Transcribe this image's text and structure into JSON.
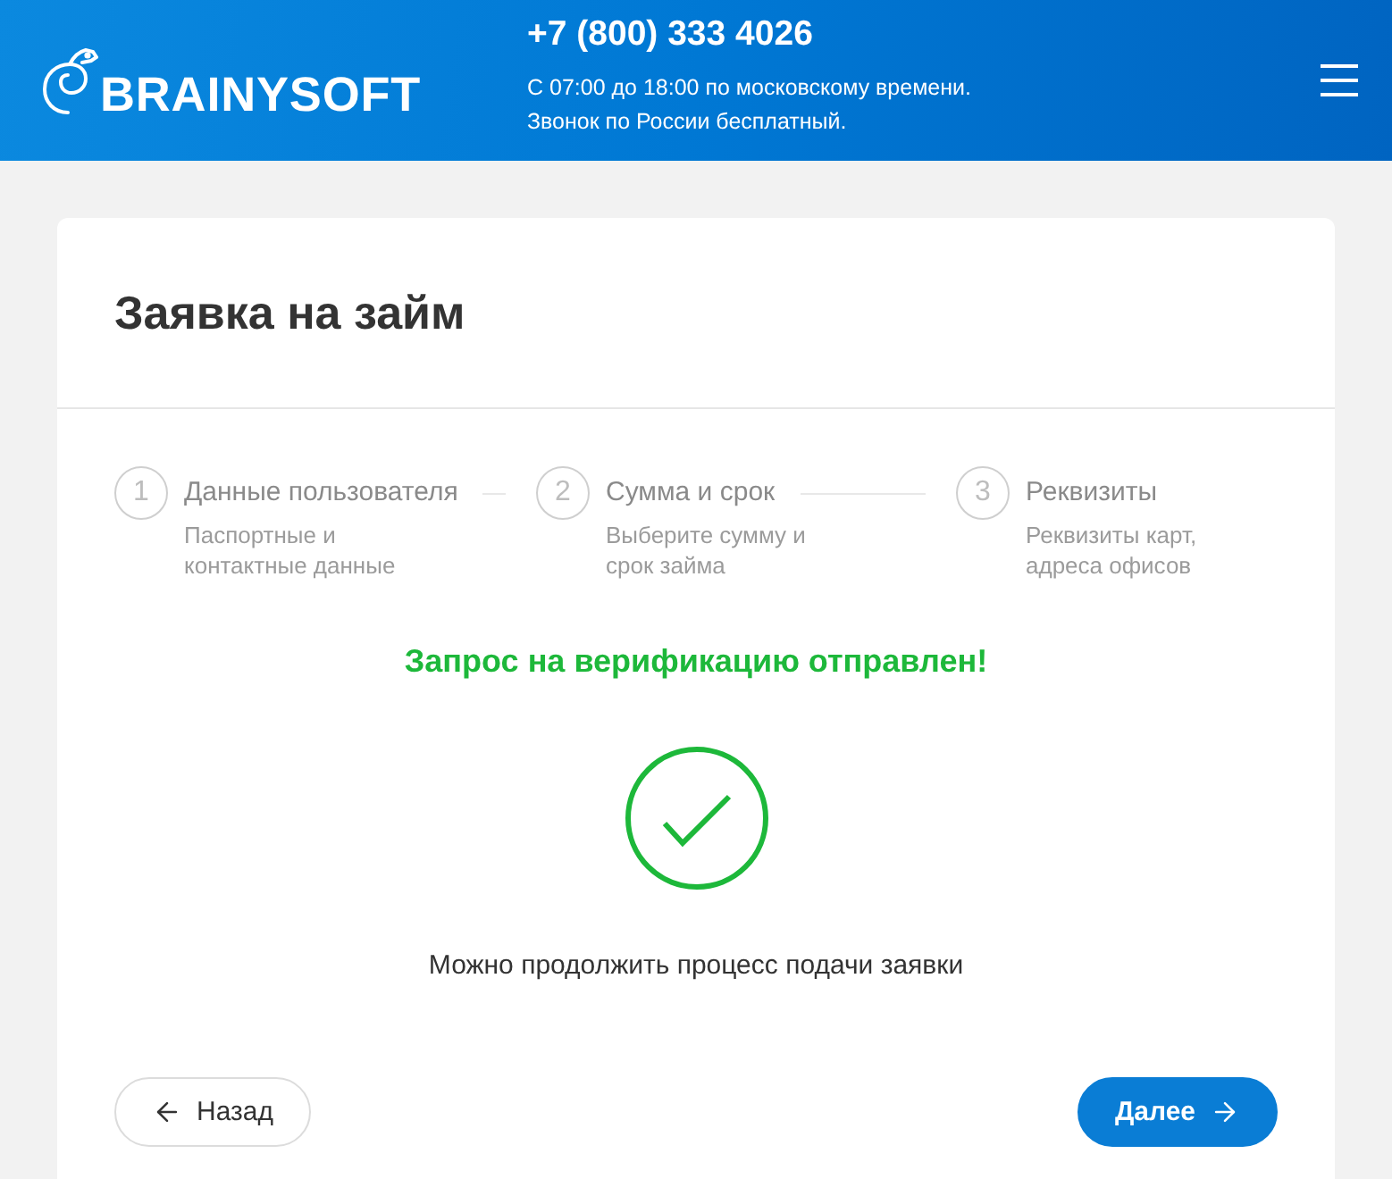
{
  "header": {
    "logo": "BRAINYSOFT",
    "phone": "+7 (800) 333 4026",
    "hours": "С 07:00 до 18:00 по московскому времени.",
    "note": "Звонок по России бесплатный."
  },
  "card": {
    "title": "Заявка на займ",
    "steps": [
      {
        "number": "1",
        "title": "Данные пользователя",
        "description": "Паспортные и контактные данные"
      },
      {
        "number": "2",
        "title": "Сумма и срок",
        "description": "Выберите сумму и срок займа"
      },
      {
        "number": "3",
        "title": "Реквизиты",
        "description": "Реквизиты карт, адреса офисов"
      }
    ],
    "status": {
      "message": "Запрос на верификацию отправлен!",
      "hint": "Можно продолжить процесс подачи заявки"
    },
    "buttons": [
      {
        "kind": "back",
        "label": "Назад"
      },
      {
        "kind": "next",
        "label": "Далее"
      }
    ]
  }
}
